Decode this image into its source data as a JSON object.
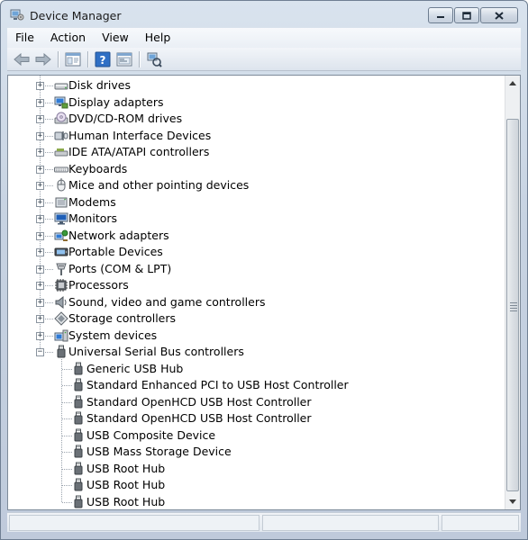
{
  "window": {
    "title": "Device Manager"
  },
  "menu": [
    "File",
    "Action",
    "View",
    "Help"
  ],
  "toolbar": {
    "buttons": [
      "back-arrow-icon",
      "forward-arrow-icon",
      "properties-pane-icon",
      "help-icon",
      "console-tree-icon",
      "scan-hardware-icon"
    ]
  },
  "tree": {
    "categories": [
      {
        "label": "Disk drives",
        "icon": "disk-drive-icon",
        "expanded": false
      },
      {
        "label": "Display adapters",
        "icon": "display-adapter-icon",
        "expanded": false
      },
      {
        "label": "DVD/CD-ROM drives",
        "icon": "dvd-drive-icon",
        "expanded": false
      },
      {
        "label": "Human Interface Devices",
        "icon": "hid-icon",
        "expanded": false
      },
      {
        "label": "IDE ATA/ATAPI controllers",
        "icon": "ide-controller-icon",
        "expanded": false
      },
      {
        "label": "Keyboards",
        "icon": "keyboard-icon",
        "expanded": false
      },
      {
        "label": "Mice and other pointing devices",
        "icon": "mouse-icon",
        "expanded": false
      },
      {
        "label": "Modems",
        "icon": "modem-icon",
        "expanded": false
      },
      {
        "label": "Monitors",
        "icon": "monitor-icon",
        "expanded": false
      },
      {
        "label": "Network adapters",
        "icon": "network-adapter-icon",
        "expanded": false
      },
      {
        "label": "Portable Devices",
        "icon": "portable-device-icon",
        "expanded": false
      },
      {
        "label": "Ports (COM & LPT)",
        "icon": "port-icon",
        "expanded": false
      },
      {
        "label": "Processors",
        "icon": "processor-icon",
        "expanded": false
      },
      {
        "label": "Sound, video and game controllers",
        "icon": "sound-icon",
        "expanded": false
      },
      {
        "label": "Storage controllers",
        "icon": "storage-controller-icon",
        "expanded": false
      },
      {
        "label": "System devices",
        "icon": "system-device-icon",
        "expanded": false
      },
      {
        "label": "Universal Serial Bus controllers",
        "icon": "usb-icon",
        "expanded": true,
        "children": [
          "Generic USB Hub",
          "Standard Enhanced PCI to USB Host Controller",
          "Standard OpenHCD USB Host Controller",
          "Standard OpenHCD USB Host Controller",
          "USB Composite Device",
          "USB Mass Storage Device",
          "USB Root Hub",
          "USB Root Hub",
          "USB Root Hub"
        ]
      }
    ]
  },
  "expander_symbols": {
    "collapsed": "+",
    "expanded": "−"
  },
  "colors": {
    "usb_plug": "#555b61",
    "selection": "#3399ff"
  }
}
